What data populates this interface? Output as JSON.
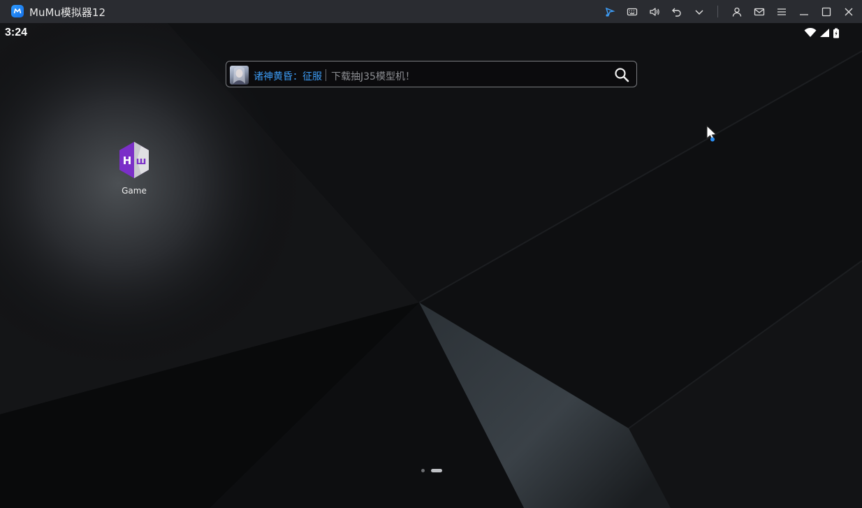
{
  "window": {
    "title": "MuMu模拟器12",
    "toolbar_icons": [
      "cursor-mode-icon",
      "keyboard-icon",
      "volume-icon",
      "back-icon",
      "chevron-down-icon",
      "account-icon",
      "mail-icon",
      "menu-icon",
      "minimize-icon",
      "maximize-icon",
      "close-icon"
    ]
  },
  "status_bar": {
    "time": "3:24",
    "icons": [
      "wifi-icon",
      "signal-icon",
      "battery-icon"
    ]
  },
  "search": {
    "promo_text": "诸神黄昏：征服",
    "placeholder": "下载抽J35模型机！"
  },
  "desktop": {
    "apps": [
      {
        "label": "Game",
        "icon": "hw-game-icon"
      }
    ]
  },
  "pager": {
    "pages": 2,
    "current": 2
  },
  "colors": {
    "titlebar_bg": "#2a2c31",
    "accent_blue": "#3d9cf5",
    "app_icon_purple": "#7b2fc8"
  }
}
